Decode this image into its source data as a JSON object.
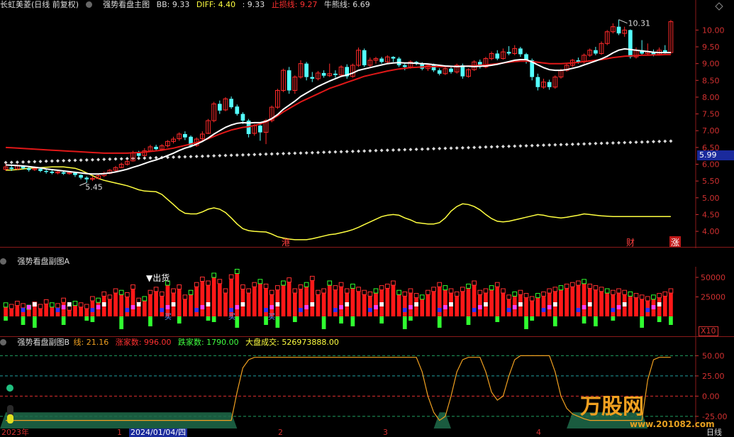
{
  "main_header": {
    "stock": "长虹美菱(日线 前复权)",
    "indicator": "强势看盘主图",
    "bb": "BB: 9.33",
    "diff": "DIFF: 4.40",
    "val": ": 9.33",
    "stop": "止损线: 9.27",
    "bull": "牛熊线: 6.69"
  },
  "sub_a_header": {
    "title": "强势看盘副图A"
  },
  "sub_b_header": {
    "title": "强势看盘副图B",
    "line": "线: 21.16",
    "up": "涨家数: 996.00",
    "down": "跌家数: 1790.00",
    "vol": "大盘成交: 526973888.00"
  },
  "price_axis": [
    "10.00",
    "9.50",
    "9.00",
    "8.50",
    "8.00",
    "7.50",
    "7.00",
    "6.50",
    "6.00",
    "5.50",
    "5.00",
    "4.50",
    "4.00"
  ],
  "current_price": "5.99",
  "sub_a_axis": [
    "50000",
    "25000"
  ],
  "sub_a_scale": "X10",
  "sub_b_axis": [
    "50.00",
    "25.00",
    "0.00",
    "-25.00"
  ],
  "annotations": {
    "high": "10.31",
    "low": "5.45",
    "sell": "▼出货",
    "buy": "买"
  },
  "events": {
    "gang": "港",
    "cai": "财",
    "zhang": "涨"
  },
  "time_axis": {
    "y2023": "2023年",
    "m1": "1",
    "date": "2024/01/04/四",
    "m2": "2",
    "m3": "3",
    "m4": "4",
    "period": "日线"
  },
  "watermark": {
    "name": "万股网",
    "url": "www.201082.com"
  },
  "colors": {
    "up": "#ff2a2a",
    "down": "#54ffff",
    "ma_white": "#ffffff",
    "ma_red": "#e01818",
    "yellow": "#ffff40",
    "dots": "#d8d8d8",
    "orange": "#f0a020"
  },
  "chart_data": {
    "type": "candlestick",
    "ylim": [
      3.6,
      10.6
    ],
    "candles": [
      {
        "o": 5.85,
        "c": 5.92,
        "h": 6.02,
        "l": 5.8
      },
      {
        "o": 5.9,
        "c": 5.86,
        "h": 5.96,
        "l": 5.8
      },
      {
        "o": 5.86,
        "c": 5.95,
        "h": 6.0,
        "l": 5.83
      },
      {
        "o": 5.94,
        "c": 5.88,
        "h": 5.97,
        "l": 5.84
      },
      {
        "o": 5.88,
        "c": 5.83,
        "h": 5.92,
        "l": 5.78
      },
      {
        "o": 5.84,
        "c": 5.87,
        "h": 5.93,
        "l": 5.8
      },
      {
        "o": 5.86,
        "c": 5.8,
        "h": 5.9,
        "l": 5.76
      },
      {
        "o": 5.8,
        "c": 5.77,
        "h": 5.84,
        "l": 5.72
      },
      {
        "o": 5.78,
        "c": 5.74,
        "h": 5.82,
        "l": 5.7
      },
      {
        "o": 5.74,
        "c": 5.77,
        "h": 5.82,
        "l": 5.7
      },
      {
        "o": 5.76,
        "c": 5.72,
        "h": 5.8,
        "l": 5.68
      },
      {
        "o": 5.72,
        "c": 5.75,
        "h": 5.8,
        "l": 5.69
      },
      {
        "o": 5.74,
        "c": 5.68,
        "h": 5.78,
        "l": 5.62
      },
      {
        "o": 5.68,
        "c": 5.6,
        "h": 5.7,
        "l": 5.55
      },
      {
        "o": 5.6,
        "c": 5.55,
        "h": 5.64,
        "l": 5.45
      },
      {
        "o": 5.55,
        "c": 5.58,
        "h": 5.64,
        "l": 5.5
      },
      {
        "o": 5.58,
        "c": 5.66,
        "h": 5.7,
        "l": 5.55
      },
      {
        "o": 5.66,
        "c": 5.73,
        "h": 5.78,
        "l": 5.62
      },
      {
        "o": 5.73,
        "c": 5.82,
        "h": 5.86,
        "l": 5.7
      },
      {
        "o": 5.82,
        "c": 5.9,
        "h": 5.95,
        "l": 5.78
      },
      {
        "o": 5.9,
        "c": 6.0,
        "h": 6.05,
        "l": 5.88
      },
      {
        "o": 6.0,
        "c": 6.08,
        "h": 6.14,
        "l": 5.96
      },
      {
        "o": 6.1,
        "c": 6.35,
        "h": 6.4,
        "l": 6.08
      },
      {
        "o": 6.33,
        "c": 6.25,
        "h": 6.4,
        "l": 6.2
      },
      {
        "o": 6.26,
        "c": 6.4,
        "h": 6.48,
        "l": 6.22
      },
      {
        "o": 6.4,
        "c": 6.52,
        "h": 6.58,
        "l": 6.36
      },
      {
        "o": 6.52,
        "c": 6.45,
        "h": 6.58,
        "l": 6.4
      },
      {
        "o": 6.45,
        "c": 6.55,
        "h": 6.6,
        "l": 6.4
      },
      {
        "o": 6.55,
        "c": 6.68,
        "h": 6.72,
        "l": 6.5
      },
      {
        "o": 6.68,
        "c": 6.75,
        "h": 6.82,
        "l": 6.62
      },
      {
        "o": 6.76,
        "c": 6.9,
        "h": 6.95,
        "l": 6.7
      },
      {
        "o": 6.9,
        "c": 6.8,
        "h": 6.98,
        "l": 6.72
      },
      {
        "o": 6.82,
        "c": 6.55,
        "h": 6.86,
        "l": 6.5
      },
      {
        "o": 6.56,
        "c": 6.75,
        "h": 6.8,
        "l": 6.52
      },
      {
        "o": 6.76,
        "c": 6.9,
        "h": 6.98,
        "l": 6.7
      },
      {
        "o": 6.92,
        "c": 7.3,
        "h": 7.35,
        "l": 6.9
      },
      {
        "o": 7.3,
        "c": 7.8,
        "h": 7.86,
        "l": 7.25
      },
      {
        "o": 7.8,
        "c": 7.6,
        "h": 7.9,
        "l": 7.5
      },
      {
        "o": 7.62,
        "c": 7.95,
        "h": 8.0,
        "l": 7.58
      },
      {
        "o": 7.95,
        "c": 7.7,
        "h": 8.02,
        "l": 7.65
      },
      {
        "o": 7.72,
        "c": 7.5,
        "h": 7.78,
        "l": 7.45
      },
      {
        "o": 7.5,
        "c": 7.3,
        "h": 7.55,
        "l": 7.2
      },
      {
        "o": 7.3,
        "c": 6.9,
        "h": 7.35,
        "l": 6.8
      },
      {
        "o": 6.92,
        "c": 7.15,
        "h": 7.2,
        "l": 6.85
      },
      {
        "o": 7.15,
        "c": 6.95,
        "h": 7.25,
        "l": 6.7
      },
      {
        "o": 6.95,
        "c": 7.3,
        "h": 7.35,
        "l": 6.6
      },
      {
        "o": 7.3,
        "c": 7.7,
        "h": 7.75,
        "l": 7.25
      },
      {
        "o": 7.7,
        "c": 8.2,
        "h": 8.25,
        "l": 7.65
      },
      {
        "o": 8.2,
        "c": 8.8,
        "h": 8.85,
        "l": 8.15
      },
      {
        "o": 8.8,
        "c": 8.2,
        "h": 8.9,
        "l": 8.1
      },
      {
        "o": 8.2,
        "c": 8.6,
        "h": 8.65,
        "l": 8.1
      },
      {
        "o": 8.6,
        "c": 9.0,
        "h": 9.1,
        "l": 8.55
      },
      {
        "o": 9.0,
        "c": 8.6,
        "h": 9.05,
        "l": 8.5
      },
      {
        "o": 8.6,
        "c": 8.55,
        "h": 8.75,
        "l": 8.45
      },
      {
        "o": 8.55,
        "c": 8.72,
        "h": 8.78,
        "l": 8.5
      },
      {
        "o": 8.72,
        "c": 8.64,
        "h": 8.8,
        "l": 8.58
      },
      {
        "o": 8.64,
        "c": 8.7,
        "h": 9.0,
        "l": 8.6
      },
      {
        "o": 8.7,
        "c": 8.66,
        "h": 8.8,
        "l": 8.58
      },
      {
        "o": 8.66,
        "c": 8.9,
        "h": 8.95,
        "l": 8.6
      },
      {
        "o": 8.9,
        "c": 8.62,
        "h": 8.98,
        "l": 8.55
      },
      {
        "o": 8.62,
        "c": 8.95,
        "h": 9.0,
        "l": 8.58
      },
      {
        "o": 8.95,
        "c": 9.4,
        "h": 9.48,
        "l": 8.9
      },
      {
        "o": 9.4,
        "c": 8.95,
        "h": 9.45,
        "l": 8.9
      },
      {
        "o": 8.95,
        "c": 9.1,
        "h": 9.18,
        "l": 8.9
      },
      {
        "o": 9.1,
        "c": 9.15,
        "h": 9.2,
        "l": 9.0
      },
      {
        "o": 9.15,
        "c": 9.05,
        "h": 9.2,
        "l": 9.0
      },
      {
        "o": 9.05,
        "c": 9.2,
        "h": 9.25,
        "l": 9.0
      },
      {
        "o": 9.2,
        "c": 9.15,
        "h": 9.22,
        "l": 9.05
      },
      {
        "o": 9.15,
        "c": 8.95,
        "h": 9.2,
        "l": 8.9
      },
      {
        "o": 8.95,
        "c": 8.9,
        "h": 9.0,
        "l": 8.8
      },
      {
        "o": 8.9,
        "c": 9.05,
        "h": 9.1,
        "l": 8.85
      },
      {
        "o": 9.05,
        "c": 9.0,
        "h": 9.08,
        "l": 8.95
      },
      {
        "o": 9.0,
        "c": 8.85,
        "h": 9.04,
        "l": 8.8
      },
      {
        "o": 8.85,
        "c": 8.95,
        "h": 9.0,
        "l": 8.78
      },
      {
        "o": 8.95,
        "c": 8.8,
        "h": 9.0,
        "l": 8.75
      },
      {
        "o": 8.8,
        "c": 8.7,
        "h": 8.86,
        "l": 8.65
      },
      {
        "o": 8.7,
        "c": 8.85,
        "h": 8.9,
        "l": 8.66
      },
      {
        "o": 8.85,
        "c": 8.75,
        "h": 8.92,
        "l": 8.7
      },
      {
        "o": 8.75,
        "c": 8.95,
        "h": 9.0,
        "l": 8.7
      },
      {
        "o": 8.95,
        "c": 8.62,
        "h": 9.0,
        "l": 8.55
      },
      {
        "o": 8.62,
        "c": 8.82,
        "h": 8.86,
        "l": 8.58
      },
      {
        "o": 8.82,
        "c": 9.05,
        "h": 9.1,
        "l": 8.78
      },
      {
        "o": 9.05,
        "c": 8.9,
        "h": 9.12,
        "l": 8.85
      },
      {
        "o": 8.9,
        "c": 9.15,
        "h": 9.2,
        "l": 8.86
      },
      {
        "o": 9.15,
        "c": 9.3,
        "h": 9.36,
        "l": 9.1
      },
      {
        "o": 9.3,
        "c": 9.15,
        "h": 9.4,
        "l": 9.1
      },
      {
        "o": 9.15,
        "c": 9.35,
        "h": 9.45,
        "l": 9.12
      },
      {
        "o": 9.35,
        "c": 9.3,
        "h": 9.52,
        "l": 9.25
      },
      {
        "o": 9.3,
        "c": 9.45,
        "h": 9.55,
        "l": 9.25
      },
      {
        "o": 9.45,
        "c": 9.28,
        "h": 9.5,
        "l": 9.2
      },
      {
        "o": 9.28,
        "c": 9.1,
        "h": 9.32,
        "l": 9.0
      },
      {
        "o": 9.1,
        "c": 8.6,
        "h": 9.15,
        "l": 8.5
      },
      {
        "o": 8.6,
        "c": 8.3,
        "h": 8.7,
        "l": 8.2
      },
      {
        "o": 8.3,
        "c": 8.45,
        "h": 8.55,
        "l": 8.25
      },
      {
        "o": 8.45,
        "c": 8.3,
        "h": 8.52,
        "l": 8.22
      },
      {
        "o": 8.3,
        "c": 8.6,
        "h": 8.65,
        "l": 8.25
      },
      {
        "o": 8.6,
        "c": 8.8,
        "h": 8.85,
        "l": 8.55
      },
      {
        "o": 8.8,
        "c": 8.95,
        "h": 9.0,
        "l": 8.76
      },
      {
        "o": 8.95,
        "c": 9.1,
        "h": 9.14,
        "l": 8.9
      },
      {
        "o": 9.1,
        "c": 9.05,
        "h": 9.18,
        "l": 9.0
      },
      {
        "o": 9.05,
        "c": 9.25,
        "h": 9.3,
        "l": 9.0
      },
      {
        "o": 9.25,
        "c": 9.4,
        "h": 9.45,
        "l": 9.2
      },
      {
        "o": 9.4,
        "c": 9.3,
        "h": 9.5,
        "l": 9.25
      },
      {
        "o": 9.3,
        "c": 9.6,
        "h": 9.66,
        "l": 9.26
      },
      {
        "o": 9.6,
        "c": 9.95,
        "h": 10.0,
        "l": 9.55
      },
      {
        "o": 9.95,
        "c": 10.1,
        "h": 10.2,
        "l": 9.9
      },
      {
        "o": 10.1,
        "c": 9.9,
        "h": 10.31,
        "l": 9.85
      },
      {
        "o": 9.9,
        "c": 10.0,
        "h": 10.1,
        "l": 9.8
      },
      {
        "o": 10.0,
        "c": 9.2,
        "h": 10.02,
        "l": 9.15
      },
      {
        "o": 9.2,
        "c": 9.4,
        "h": 9.48,
        "l": 9.15
      },
      {
        "o": 9.4,
        "c": 9.3,
        "h": 9.7,
        "l": 9.25
      },
      {
        "o": 9.3,
        "c": 9.35,
        "h": 9.6,
        "l": 9.25
      },
      {
        "o": 9.35,
        "c": 9.28,
        "h": 9.42,
        "l": 9.22
      },
      {
        "o": 9.28,
        "c": 9.4,
        "h": 9.48,
        "l": 9.24
      },
      {
        "o": 9.4,
        "c": 9.33,
        "h": 9.55,
        "l": 9.3
      },
      {
        "o": 9.33,
        "c": 10.25,
        "h": 10.3,
        "l": 9.3
      }
    ],
    "ma_white": [
      5.98,
      5.97,
      5.96,
      5.95,
      5.93,
      5.91,
      5.89,
      5.86,
      5.84,
      5.82,
      5.8,
      5.78,
      5.76,
      5.74,
      5.72,
      5.71,
      5.71,
      5.72,
      5.74,
      5.77,
      5.81,
      5.85,
      5.91,
      5.96,
      6.02,
      6.08,
      6.13,
      6.19,
      6.26,
      6.33,
      6.41,
      6.48,
      6.53,
      6.6,
      6.68,
      6.78,
      6.9,
      7.0,
      7.1,
      7.17,
      7.22,
      7.24,
      7.23,
      7.24,
      7.24,
      7.28,
      7.36,
      7.48,
      7.64,
      7.76,
      7.88,
      8.02,
      8.12,
      8.22,
      8.32,
      8.4,
      8.48,
      8.55,
      8.62,
      8.66,
      8.72,
      8.8,
      8.84,
      8.88,
      8.92,
      8.96,
      9.0,
      9.02,
      9.03,
      9.02,
      9.02,
      9.01,
      9.0,
      8.99,
      8.97,
      8.95,
      8.93,
      8.92,
      8.91,
      8.92,
      8.92,
      8.91,
      8.92,
      8.93,
      8.95,
      8.98,
      9.02,
      9.06,
      9.1,
      9.12,
      9.12,
      9.05,
      8.96,
      8.88,
      8.82,
      8.8,
      8.8,
      8.82,
      8.86,
      8.9,
      8.96,
      9.02,
      9.08,
      9.14,
      9.22,
      9.32,
      9.4,
      9.44,
      9.42,
      9.4,
      9.38,
      9.36,
      9.34,
      9.33,
      9.33,
      9.33
    ],
    "ma_red": [
      6.5,
      6.49,
      6.48,
      6.47,
      6.46,
      6.45,
      6.44,
      6.43,
      6.42,
      6.41,
      6.4,
      6.39,
      6.38,
      6.37,
      6.36,
      6.35,
      6.34,
      6.33,
      6.33,
      6.33,
      6.33,
      6.33,
      6.34,
      6.35,
      6.36,
      6.38,
      6.4,
      6.42,
      6.45,
      6.48,
      6.52,
      6.56,
      6.6,
      6.65,
      6.7,
      6.76,
      6.83,
      6.9,
      6.96,
      7.02,
      7.06,
      7.1,
      7.12,
      7.16,
      7.2,
      7.26,
      7.34,
      7.44,
      7.56,
      7.66,
      7.76,
      7.86,
      7.94,
      8.02,
      8.1,
      8.18,
      8.26,
      8.32,
      8.38,
      8.44,
      8.5,
      8.56,
      8.62,
      8.66,
      8.7,
      8.74,
      8.78,
      8.81,
      8.84,
      8.86,
      8.88,
      8.89,
      8.9,
      8.91,
      8.91,
      8.91,
      8.91,
      8.91,
      8.92,
      8.92,
      8.93,
      8.94,
      8.95,
      8.96,
      8.98,
      9.0,
      9.02,
      9.04,
      9.06,
      9.07,
      9.07,
      9.06,
      9.04,
      9.02,
      9.0,
      9.0,
      9.0,
      9.01,
      9.02,
      9.04,
      9.06,
      9.08,
      9.1,
      9.12,
      9.15,
      9.18,
      9.2,
      9.22,
      9.23,
      9.24,
      9.25,
      9.25,
      9.26,
      9.26,
      9.27,
      9.27
    ],
    "yellow": [
      5.82,
      5.83,
      5.84,
      5.86,
      5.88,
      5.89,
      5.9,
      5.91,
      5.92,
      5.92,
      5.92,
      5.9,
      5.88,
      5.82,
      5.74,
      5.66,
      5.58,
      5.52,
      5.48,
      5.44,
      5.4,
      5.36,
      5.3,
      5.24,
      5.2,
      5.19,
      5.18,
      5.1,
      4.95,
      4.8,
      4.64,
      4.54,
      4.52,
      4.52,
      4.58,
      4.66,
      4.7,
      4.66,
      4.56,
      4.4,
      4.22,
      4.08,
      4.02,
      4.0,
      3.99,
      3.98,
      3.92,
      3.84,
      3.8,
      3.77,
      3.75,
      3.75,
      3.75,
      3.78,
      3.82,
      3.86,
      3.9,
      3.92,
      3.96,
      4.0,
      4.05,
      4.12,
      4.2,
      4.28,
      4.36,
      4.44,
      4.48,
      4.5,
      4.48,
      4.4,
      4.34,
      4.26,
      4.24,
      4.22,
      4.22,
      4.26,
      4.4,
      4.6,
      4.74,
      4.82,
      4.8,
      4.74,
      4.64,
      4.5,
      4.38,
      4.3,
      4.28,
      4.3,
      4.34,
      4.38,
      4.42,
      4.46,
      4.5,
      4.48,
      4.44,
      4.42,
      4.4,
      4.42,
      4.45,
      4.48,
      4.52,
      4.5,
      4.48,
      4.46,
      4.45,
      4.44,
      4.44,
      4.44,
      4.44,
      4.44,
      4.44,
      4.44,
      4.44,
      4.44,
      4.44,
      4.44
    ],
    "bull_dots": [
      6.05,
      6.69
    ],
    "sub_a_bars": [
      12,
      10,
      14,
      11,
      9,
      13,
      10,
      16,
      12,
      11,
      18,
      8,
      14,
      12,
      10,
      20,
      18,
      26,
      22,
      30,
      28,
      25,
      35,
      18,
      20,
      28,
      32,
      26,
      40,
      30,
      35,
      22,
      28,
      38,
      45,
      40,
      50,
      42,
      30,
      48,
      55,
      35,
      30,
      38,
      42,
      36,
      28,
      34,
      40,
      44,
      30,
      35,
      38,
      46,
      28,
      30,
      40,
      34,
      38,
      30,
      36,
      32,
      28,
      26,
      30,
      34,
      36,
      40,
      28,
      26,
      30,
      24,
      22,
      28,
      32,
      38,
      34,
      30,
      26,
      32,
      36,
      40,
      28,
      30,
      34,
      38,
      30,
      22,
      26,
      28,
      24,
      20,
      24,
      26,
      30,
      32,
      34,
      36,
      38,
      40,
      42,
      36,
      34,
      32,
      30,
      28,
      30,
      28,
      26,
      24,
      22,
      20,
      22,
      24,
      26,
      30
    ],
    "sub_b_line": [
      -30,
      -30,
      -30,
      -30,
      -30,
      -30,
      -30,
      -30,
      -30,
      -30,
      -30,
      -30,
      -30,
      -30,
      -30,
      -30,
      -30,
      -30,
      -30,
      -30,
      -30,
      -30,
      -30,
      -30,
      -30,
      -30,
      -30,
      -30,
      -30,
      -30,
      -30,
      -30,
      -30,
      -30,
      -30,
      -30,
      -30,
      -30,
      -30,
      -30,
      5,
      35,
      45,
      48,
      48,
      48,
      48,
      48,
      48,
      48,
      48,
      48,
      48,
      48,
      48,
      48,
      48,
      48,
      48,
      48,
      48,
      48,
      48,
      48,
      48,
      48,
      48,
      48,
      48,
      48,
      48,
      48,
      30,
      0,
      -20,
      -30,
      -25,
      0,
      30,
      45,
      48,
      48,
      48,
      30,
      5,
      -5,
      0,
      25,
      45,
      50,
      50,
      50,
      50,
      50,
      50,
      30,
      0,
      -15,
      -22,
      -25,
      -28,
      -30,
      -30,
      -30,
      -30,
      -30,
      -30,
      -30,
      -30,
      -30,
      -30,
      20,
      45,
      48,
      48,
      48
    ]
  }
}
